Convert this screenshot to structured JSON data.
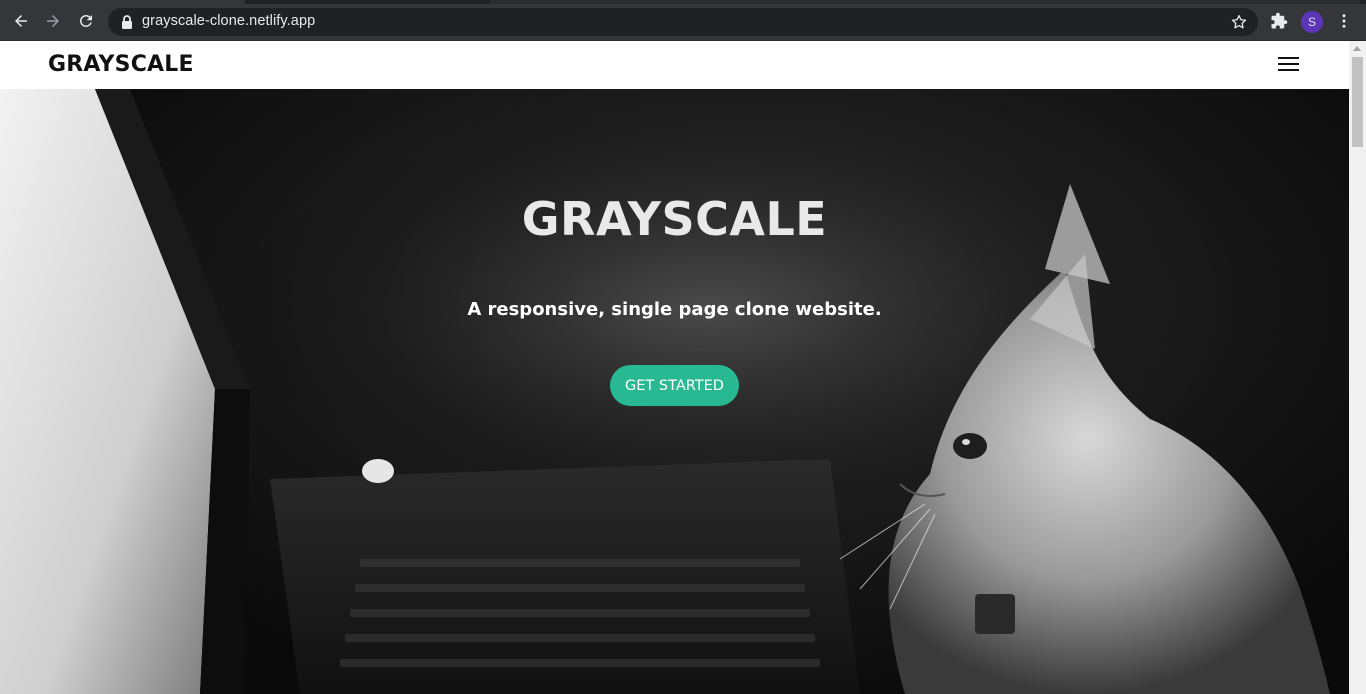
{
  "browser": {
    "url": "grayscale-clone.netlify.app",
    "avatar_initial": "S",
    "icons": {
      "back": "arrow-left-icon",
      "forward": "arrow-right-icon",
      "reload": "reload-icon",
      "lock": "lock-icon",
      "bookmark": "star-icon",
      "extensions": "puzzle-icon",
      "menu": "kebab-menu-icon"
    },
    "colors": {
      "chrome": "#35363a",
      "omnibox": "#202124",
      "avatar": "#5b35b8"
    }
  },
  "navbar": {
    "brand": "GRAYSCALE",
    "menu_icon": "hamburger-icon"
  },
  "hero": {
    "title": "GRAYSCALE",
    "subtitle": "A responsive, single page clone website.",
    "cta_label": "GET STARTED",
    "colors": {
      "cta": "#29b992",
      "title": "#e9e9e9"
    }
  }
}
